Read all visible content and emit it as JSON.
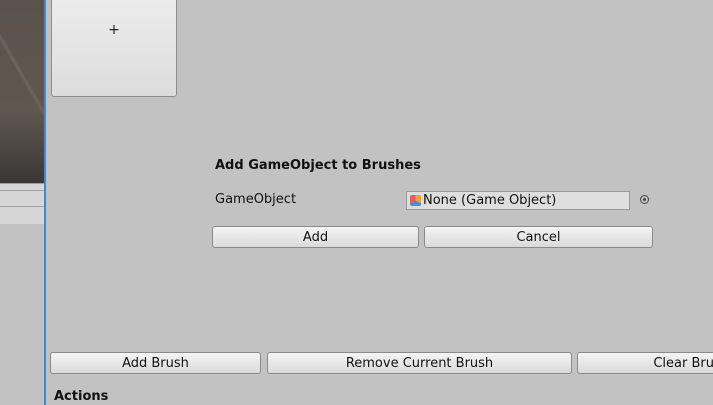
{
  "brush_tile": {
    "plus_label": "+"
  },
  "dialog": {
    "title": "Add GameObject to Brushes",
    "field_label": "GameObject",
    "field_value": "None (Game Object)",
    "add_label": "Add",
    "cancel_label": "Cancel"
  },
  "toolbar": {
    "add_brush_label": "Add Brush",
    "remove_brush_label": "Remove Current Brush",
    "clear_brush_label": "Clear Bru"
  },
  "section": {
    "actions_label": "Actions"
  },
  "colors": {
    "panel_bg": "#c2c2c2",
    "focus_border": "#3d89d8",
    "button_border": "#8a8a8a"
  },
  "icons": {
    "gameobject": "gameobject-icon",
    "picker": "object-picker-icon"
  }
}
